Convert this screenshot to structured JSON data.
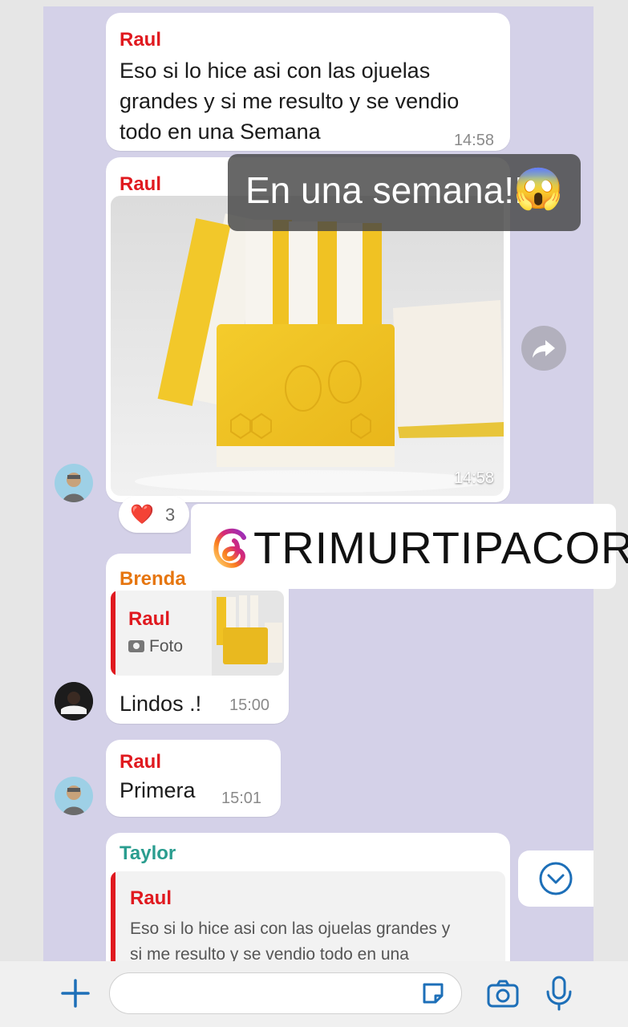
{
  "messages": {
    "m1": {
      "sender": "Raul",
      "text": "Eso si lo hice asi con las ojuelas grandes y si me resulto y se vendio todo en una Semana",
      "line1": "Eso si lo hice asi con las ojuelas",
      "line2": "grandes y si me resulto y se vendio",
      "line3": "todo en una Semana",
      "time": "14:58"
    },
    "m2": {
      "sender": "Raul",
      "time": "14:58",
      "reaction_emoji": "❤️",
      "reaction_count": "3"
    },
    "m3": {
      "sender": "Brenda",
      "quote_sender": "Raul",
      "quote_media": "Foto",
      "text": "Lindos .!",
      "time": "15:00"
    },
    "m4": {
      "sender": "Raul",
      "text": "Primera",
      "time": "15:01"
    },
    "m5": {
      "sender": "Taylor",
      "quote_sender": "Raul",
      "quote_line1": "Eso si lo hice asi con las ojuelas grandes y",
      "quote_line2": "si me resulto y se vendio todo en una"
    }
  },
  "overlay": {
    "text": "En una semana!!",
    "emoji": "😱"
  },
  "instagram": {
    "handle": "TRIMURTIPACORI"
  },
  "colors": {
    "raul": "#e0191f",
    "brenda": "#e6760f",
    "taylor": "#2a9d8f",
    "chat_bg": "#d4d1e8"
  }
}
